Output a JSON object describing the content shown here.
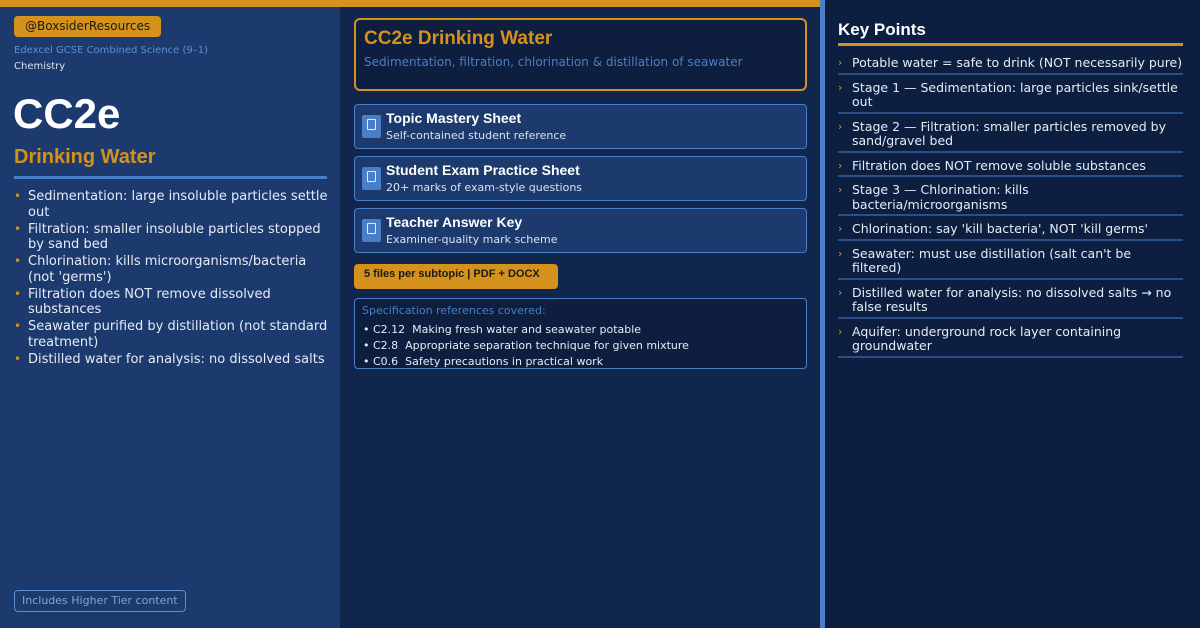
{
  "left": {
    "handle": "@BoxsiderResources",
    "exam_board": "Edexcel GCSE Combined Science (9–1)",
    "subject": "Chemistry",
    "code": "CC2e",
    "title": "Drinking Water",
    "bullets": [
      "Sedimentation: large insoluble particles settle out",
      "Filtration: smaller insoluble particles stopped by sand bed",
      "Chlorination: kills microorganisms/bacteria (not 'germs')",
      "Filtration does NOT remove dissolved substances",
      "Seawater purified by distillation (not standard treatment)",
      "Distilled water for analysis: no dissolved salts"
    ],
    "higher_tier": "Includes Higher Tier content"
  },
  "middle": {
    "hero_title": "CC2e Drinking Water",
    "hero_subtitle": "Sedimentation, filtration, chlorination & distillation of seawater",
    "cards": [
      {
        "title": "Topic Mastery Sheet",
        "desc": "Self-contained student reference"
      },
      {
        "title": "Student Exam Practice Sheet",
        "desc": "20+ marks of exam-style questions"
      },
      {
        "title": "Teacher Answer Key",
        "desc": "Examiner-quality mark scheme"
      }
    ],
    "files_badge": "5 files per subtopic  |  PDF + DOCX",
    "spec_title": "Specification references covered:",
    "spec_items": [
      "• C2.12  Making fresh water and seawater potable",
      "• C2.8  Appropriate separation technique for given mixture",
      "• C0.6  Safety precautions in practical work"
    ]
  },
  "right": {
    "title": "Key Points",
    "points": [
      "Potable water = safe to drink (NOT necessarily pure)",
      "Stage 1 — Sedimentation: large particles sink/settle out",
      "Stage 2 — Filtration: smaller particles removed by sand/gravel bed",
      "Filtration does NOT remove soluble substances",
      "Stage 3 — Chlorination: kills bacteria/microorganisms",
      "Chlorination: say 'kill bacteria', NOT 'kill germs'",
      "Seawater: must use distillation (salt can't be filtered)",
      "Distilled water for analysis: no dissolved salts → no false results",
      "Aquifer: underground rock layer containing groundwater"
    ]
  },
  "colors": {
    "accent": "#d4921c",
    "blue": "#4a7fc7",
    "panel": "#1c3a6e",
    "background": "#0f2347"
  },
  "icons": {
    "card_icon": "document-icon",
    "bullet": "bullet-dot",
    "key_point": "chevron-right-icon"
  }
}
